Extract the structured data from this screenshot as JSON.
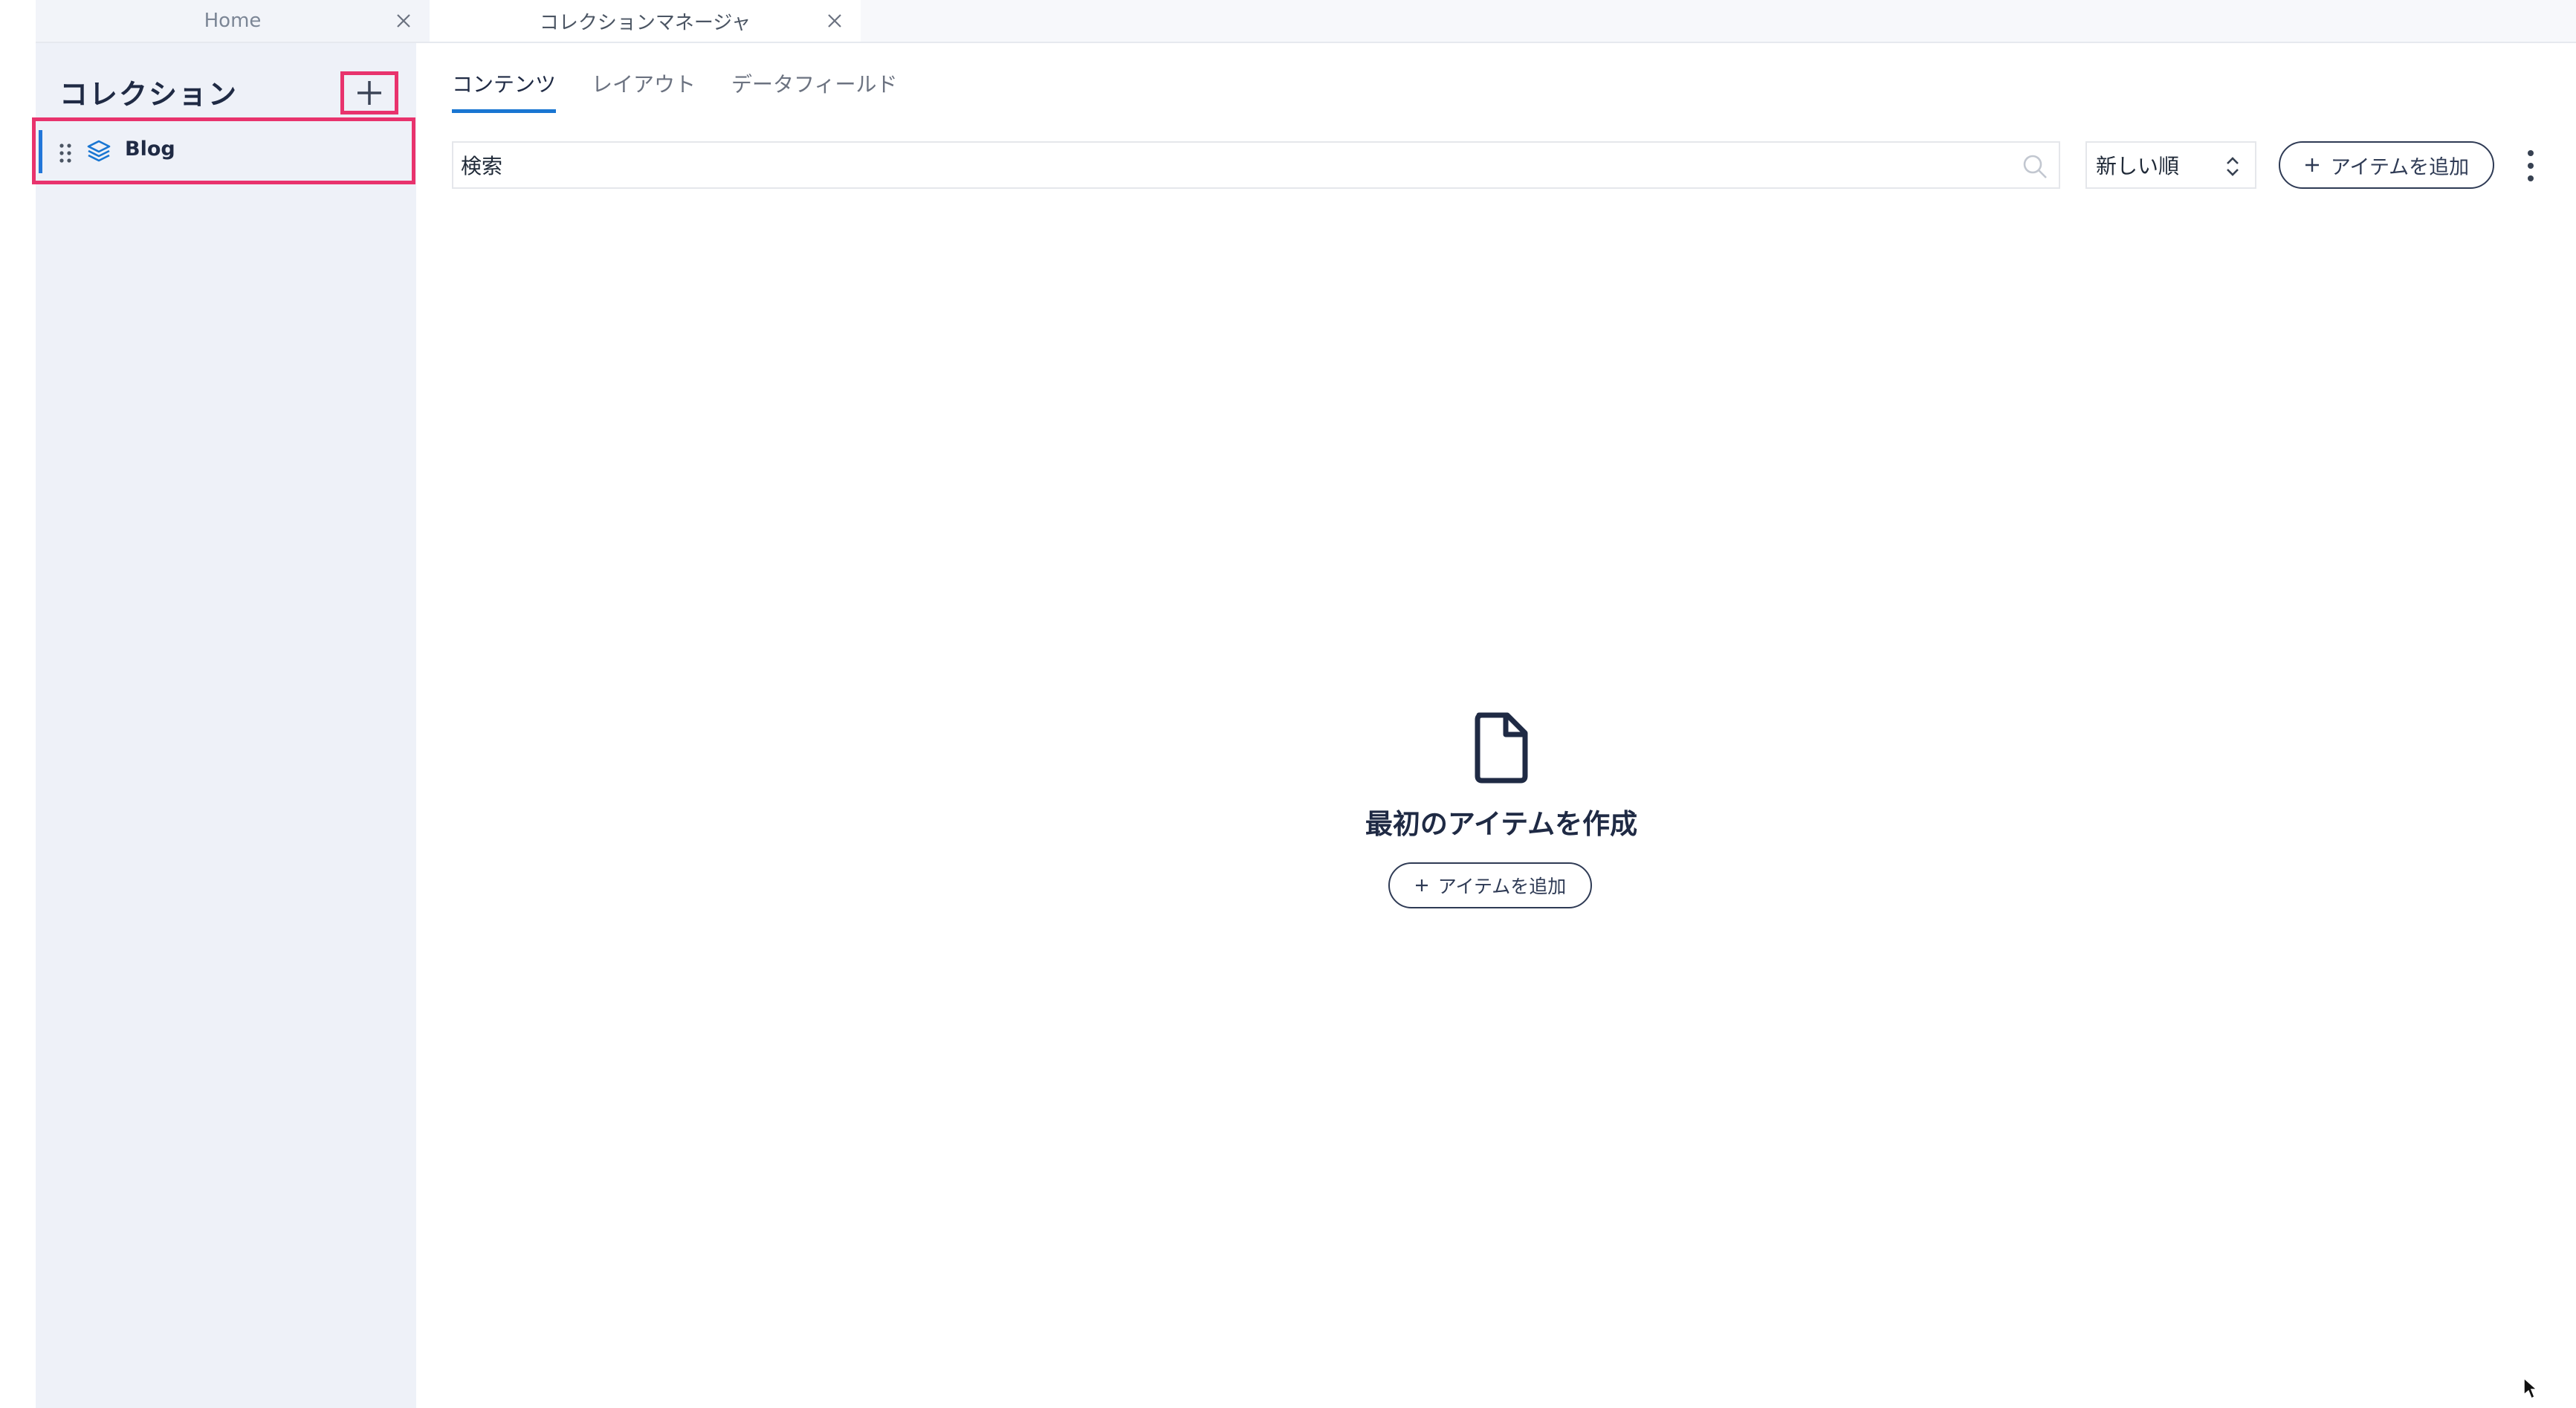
{
  "tabs": [
    {
      "label": "Home"
    },
    {
      "label": "コレクションマネージャ"
    }
  ],
  "sidebar": {
    "title": "コレクション",
    "items": [
      {
        "label": "Blog"
      }
    ]
  },
  "main": {
    "tabs": [
      {
        "label": "コンテンツ",
        "active": true
      },
      {
        "label": "レイアウト",
        "active": false
      },
      {
        "label": "データフィールド",
        "active": false
      }
    ],
    "search": {
      "placeholder": "検索",
      "value": ""
    },
    "sort": {
      "selected": "新しい順"
    },
    "add_item_label": "アイテムを追加",
    "empty_state": {
      "title": "最初のアイテムを作成",
      "button_label": "アイテムを追加"
    }
  },
  "icons": {
    "tab_close": "close-icon",
    "add_collection": "plus-icon",
    "drag": "drag-handle-icon",
    "collection": "layers-icon",
    "search": "search-icon",
    "sort": "sort-arrows-icon",
    "more": "kebab-menu-icon",
    "empty": "document-icon"
  },
  "colors": {
    "accent": "#1976d2",
    "highlight": "#e8336d",
    "sidebar_bg": "#eef1f8",
    "text_dark": "#1f2a44"
  }
}
